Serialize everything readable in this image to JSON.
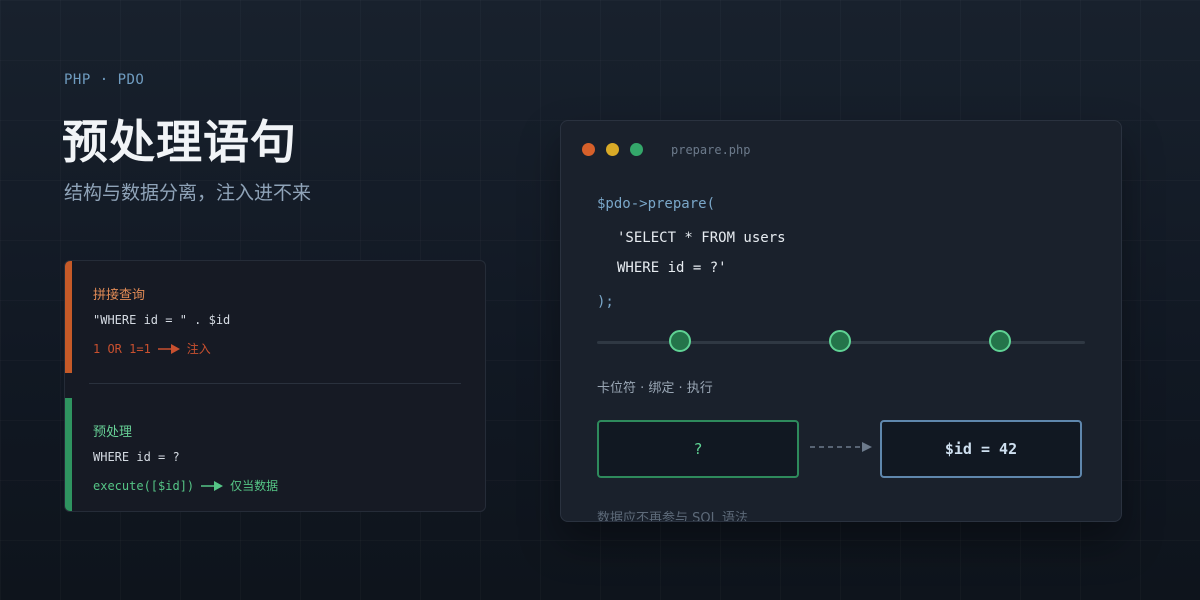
{
  "header": {
    "eyebrow": "PHP · PDO",
    "title": "预处理语句",
    "subtitle": "结构与数据分离，注入进不来"
  },
  "comparison": {
    "bad": {
      "title": "拼接查询",
      "code": "\"WHERE id = \" . $id",
      "input": "1 OR 1=1",
      "outcome": "注入",
      "color": "#c65a28"
    },
    "good": {
      "title": "预处理",
      "code": "WHERE id = ?",
      "input": "execute([$id])",
      "outcome": "仅当数据",
      "color": "#2f9460"
    }
  },
  "editor": {
    "filename": "prepare.php",
    "lines": [
      "$pdo->prepare(",
      "'SELECT * FROM users",
      "WHERE id = ?'",
      ");"
    ],
    "steps": "卡位符 · 绑定 · 执行",
    "placeholder": "?",
    "value": "$id = 42",
    "note": "数据应不再参与 SQL 语法",
    "traffic_lights": [
      "#d6602a",
      "#d9aa27",
      "#34a76a"
    ]
  }
}
